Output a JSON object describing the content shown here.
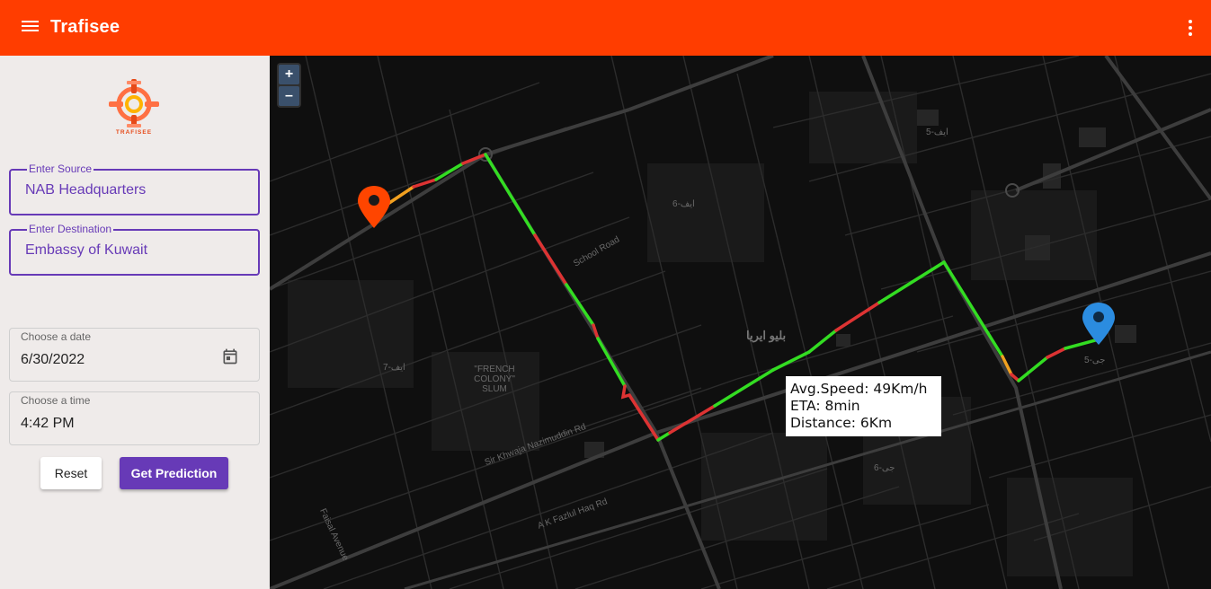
{
  "app": {
    "title": "Trafisee"
  },
  "logo": {
    "text": "TRAFISEE"
  },
  "form": {
    "source": {
      "label": "Enter Source",
      "value": "NAB Headquarters"
    },
    "destination": {
      "label": "Enter Destination",
      "value": "Embassy of Kuwait"
    },
    "date": {
      "label": "Choose a date",
      "value": "6/30/2022"
    },
    "time": {
      "label": "Choose a time",
      "value": "4:42 PM"
    },
    "reset_label": "Reset",
    "predict_label": "Get Prediction"
  },
  "map": {
    "zoom_in": "+",
    "zoom_out": "–",
    "tooltip": {
      "speed": "Avg.Speed: 49Km/h",
      "eta": "ETA: 8min",
      "distance": "Distance: 6Km"
    },
    "labels": {
      "f6": "ایف-6",
      "f7": "ایف-7",
      "g5": "جی-5",
      "g6": "جی-6",
      "f5": "ایف-5",
      "blue_area": "بلیو ایریا",
      "french_colony": "\"FRENCH COLONY\" SLUM",
      "school_road": "School Road",
      "faisal": "Faisal Avenue",
      "nazimuddin": "Sir Khwaja Nazimuddin Rd",
      "fazlul": "A K Fazlul Haq Rd"
    },
    "colors": {
      "background": "#0f0f0f",
      "fast": "#33dd22",
      "slow": "#dd3333",
      "medium": "#f0a020",
      "source_pin": "#ff4500",
      "dest_pin": "#2b8ce0"
    }
  }
}
